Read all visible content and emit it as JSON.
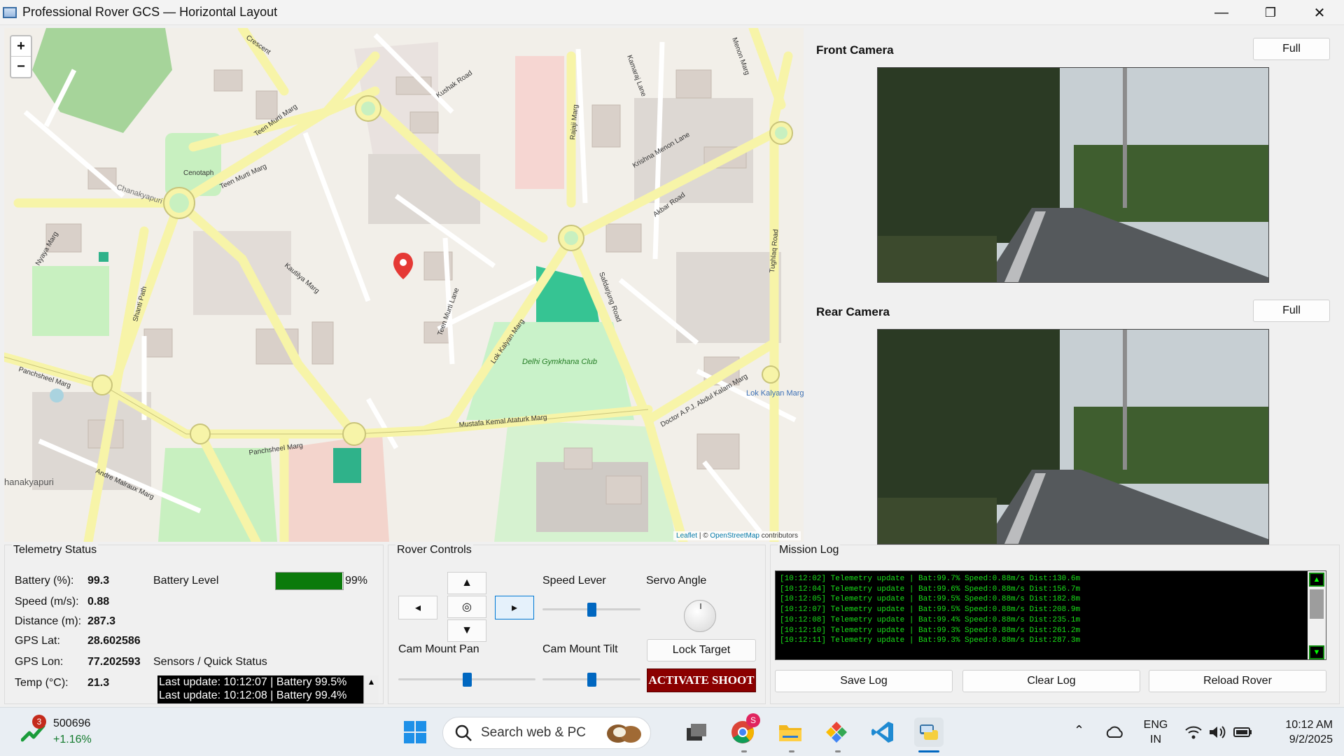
{
  "window": {
    "title": "Professional Rover GCS — Horizontal Layout",
    "controls": [
      "minimize",
      "restore",
      "close"
    ]
  },
  "map": {
    "zoom_in": "+",
    "zoom_out": "−",
    "attribution_prefix": "Leaflet",
    "attribution_sep": " | © ",
    "attribution_osm": "OpenStreetMap",
    "attribution_suffix": " contributors",
    "labels": {
      "cenotaph": "Cenotaph",
      "chanakyapuri": "Chanakyapuri",
      "chanakyapuri2": "hanakyapuri",
      "teen_murti_marg": "Teen Murti Marg",
      "teen_murti_marg2": "Teen Murti Marg",
      "akbar_road": "Akbar Road",
      "safdarjung_road": "Safdarjung Road",
      "delhi_gymkhana": "Delhi Gymkhana Club",
      "mustafa_kemal": "Mustafa Kemal Ataturk Marg",
      "panchsheel_marg": "Panchsheel Marg",
      "panchsheel_marg2": "Panchsheel Marg",
      "lok_kalyan_marg": "Lok Kalyan Marg",
      "abdul_kalam": "Doctor A.P.J. Abdul Kalam Marg",
      "tughlaq_road": "Tughlaq Road",
      "kautilya_marg": "Kautilya Marg",
      "shanti_path": "Shanti Path",
      "kushak_road": "Kushak Road",
      "rajaji_marg": "Rajaji Marg",
      "krishna_menon": "Krishna Menon Lane",
      "kamaraj_lane": "Kamaraj Lane",
      "nyaya_marg": "Nyaya Marg",
      "andre_malraux": "Andre Malraux Marg",
      "teen_murti_lane": "Teen Murti Lane",
      "crescent": "Crescent",
      "menon_marg": "Menon Marg",
      "lok_kalyan_marg_blue": "Lok Kalyan Marg"
    }
  },
  "cameras": {
    "front": {
      "label": "Front Camera",
      "button": "Full"
    },
    "rear": {
      "label": "Rear Camera",
      "button": "Full"
    }
  },
  "telemetry": {
    "title": "Telemetry  Status",
    "rows": [
      {
        "label": "Battery (%):",
        "value": "99.3"
      },
      {
        "label": "Speed (m/s):",
        "value": "0.88"
      },
      {
        "label": "Distance (m):",
        "value": "287.3"
      },
      {
        "label": "GPS Lat:",
        "value": "28.602586"
      },
      {
        "label": "GPS Lon:",
        "value": "77.202593"
      },
      {
        "label": "Temp (°C):",
        "value": "21.3"
      }
    ],
    "battery_level_label": "Battery Level",
    "battery_level_percent": 99,
    "battery_level_text": "99%",
    "quick_status_label": "Sensors / Quick Status",
    "status_lines": [
      "Last update: 10:12:07 | Battery 99.5%",
      "Last update: 10:12:08 | Battery 99.4%"
    ]
  },
  "rover_controls": {
    "title": "Rover Controls",
    "up": "▲",
    "down": "▼",
    "left": "◂",
    "right": "▸",
    "center": "◎",
    "speed_lever_label": "Speed Lever",
    "speed_lever_value": 0.5,
    "servo_angle_label": "Servo Angle",
    "cam_pan_label": "Cam Mount Pan",
    "cam_pan_value": 0.5,
    "cam_tilt_label": "Cam Mount Tilt",
    "cam_tilt_value": 0.5,
    "lock_target": "Lock Target",
    "activate_shoot": "ACTIVATE SHOOT"
  },
  "mission_log": {
    "title": "Mission Log",
    "lines": [
      "[10:12:02] Telemetry update | Bat:99.7% Speed:0.88m/s Dist:130.6m",
      "[10:12:04] Telemetry update | Bat:99.6% Speed:0.88m/s Dist:156.7m",
      "[10:12:05] Telemetry update | Bat:99.5% Speed:0.88m/s Dist:182.8m",
      "[10:12:07] Telemetry update | Bat:99.5% Speed:0.88m/s Dist:208.9m",
      "[10:12:08] Telemetry update | Bat:99.4% Speed:0.88m/s Dist:235.1m",
      "[10:12:10] Telemetry update | Bat:99.3% Speed:0.88m/s Dist:261.2m",
      "[10:12:11] Telemetry update | Bat:99.3% Speed:0.88m/s Dist:287.3m"
    ],
    "save_log": "Save Log",
    "clear_log": "Clear Log",
    "reload_rover": "Reload Rover"
  },
  "taskbar": {
    "stock_value": "500696",
    "stock_change": "+1.16%",
    "stock_badge": "3",
    "search_placeholder": "Search web & PC",
    "chrome_badge": "S",
    "lang_line1": "ENG",
    "lang_line2": "IN",
    "time": "10:12 AM",
    "date": "9/2/2025"
  }
}
